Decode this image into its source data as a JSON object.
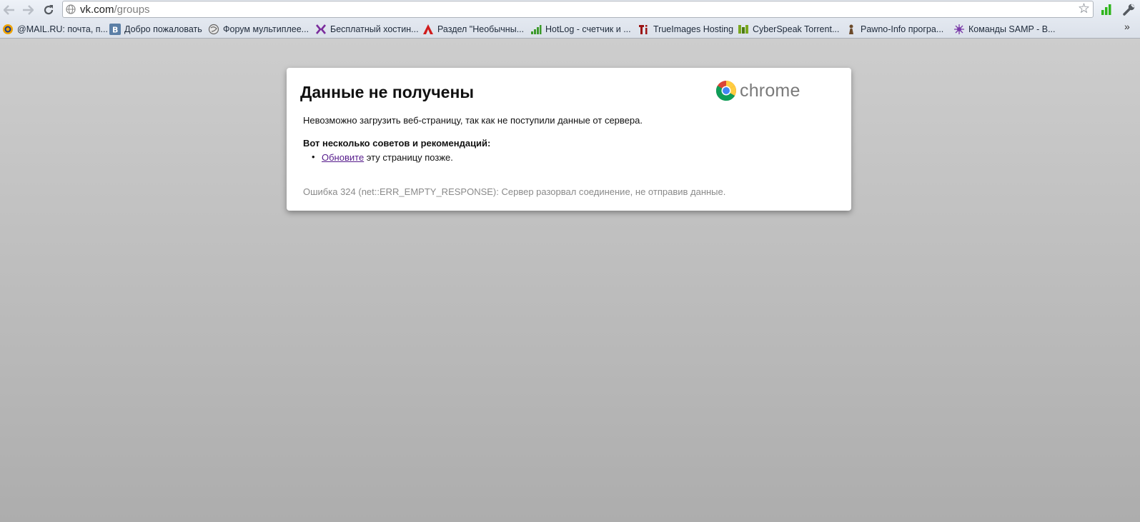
{
  "toolbar": {
    "url_host": "vk.com",
    "url_path": "/groups",
    "icons": [
      "back-icon",
      "forward-icon",
      "reload-icon",
      "globe-icon",
      "star-icon",
      "signal-icon",
      "wrench-icon"
    ]
  },
  "bookmarks": [
    {
      "label": "@MAIL.RU: почта, п...",
      "icon": "mailru-icon"
    },
    {
      "label": "Добро пожаловать",
      "icon": "vk-icon"
    },
    {
      "label": "Форум мультиплее...",
      "icon": "forum-icon"
    },
    {
      "label": "Бесплатный хостин...",
      "icon": "hosting-icon"
    },
    {
      "label": "Раздел \"Необычны...",
      "icon": "a-logo-icon"
    },
    {
      "label": "HotLog - счетчик и ...",
      "icon": "hotlog-icon"
    },
    {
      "label": "TrueImages Hosting",
      "icon": "trueimages-icon"
    },
    {
      "label": "CyberSpeak Torrent...",
      "icon": "cyberspeak-icon"
    },
    {
      "label": "Pawno-Info програ...",
      "icon": "pawno-icon"
    },
    {
      "label": "Команды SAMP - В...",
      "icon": "samp-icon"
    }
  ],
  "overflow_label": "»",
  "error_page": {
    "title": "Данные не получены",
    "logo_text": "chrome",
    "description": "Невозможно загрузить веб-страницу, так как не поступили данные от сервера.",
    "tips_title": "Вот несколько советов и рекомендаций:",
    "tip_link": "Обновите",
    "tip_rest": " эту страницу позже.",
    "error_text": "Ошибка 324 (net::ERR_EMPTY_RESPONSE): Сервер разорвал соединение, не отправив данные."
  },
  "colors": {
    "link_visited": "#551a8b",
    "error_text": "#8a8a8a",
    "background_top": "#cdcdcd",
    "background_bottom": "#adadad"
  }
}
